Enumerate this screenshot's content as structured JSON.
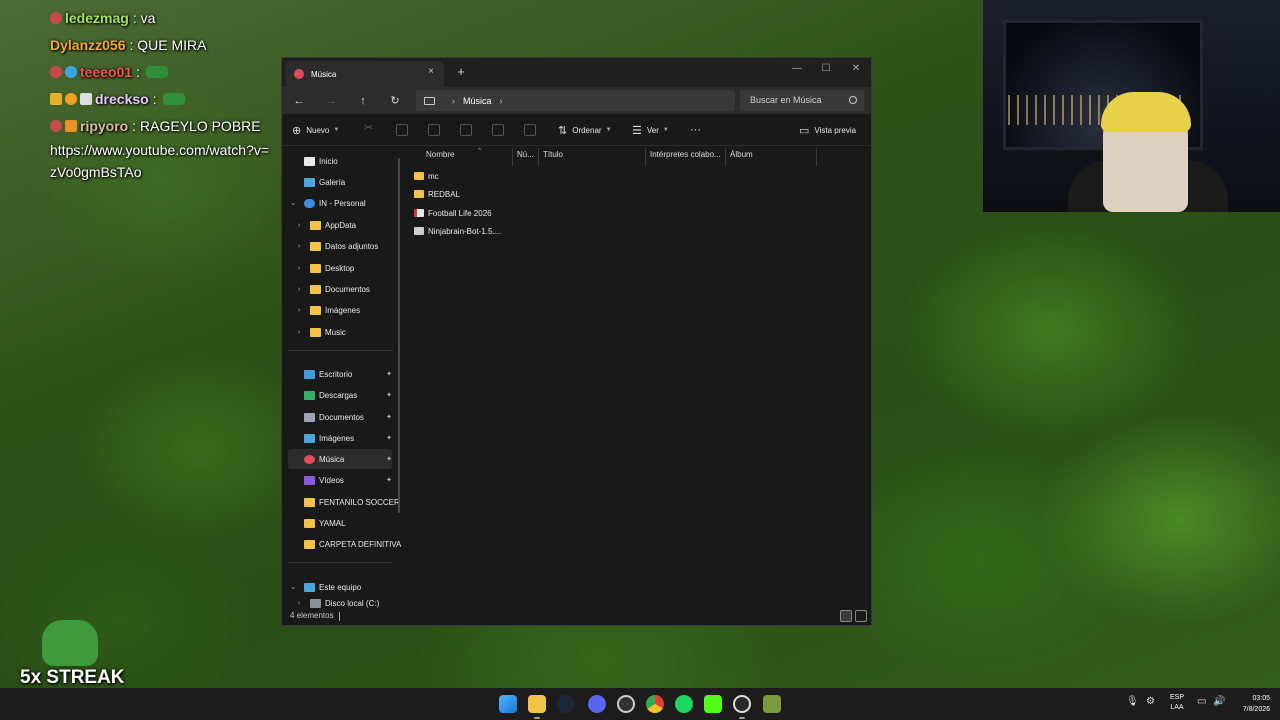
{
  "chat": {
    "messages": [
      {
        "user": "ledezmag",
        "user_color": "#a6e35a",
        "text": ": va"
      },
      {
        "user": "Dylanzz056",
        "user_color": "#f2a93b",
        "text": ": QUE MIRA"
      },
      {
        "user": "teeeo01",
        "user_color": "#ff4f4f",
        "text": ":"
      },
      {
        "user": "dreckso",
        "user_color": "#e8c9ff",
        "text": ":"
      },
      {
        "user": "ripyoro",
        "user_color": "#d9b9a0",
        "text": ": RAGEYLO POBRE"
      }
    ],
    "url_message": "https://www.youtube.com/watch?v=zVo0gmBsTAo"
  },
  "streak": {
    "label": "5x STREAK"
  },
  "explorer": {
    "tab_title": "Música",
    "tab_close": "×",
    "new_tab": "+",
    "breadcrumb": "Música",
    "search_placeholder": "Buscar en Música",
    "commands": {
      "new": "Nuevo",
      "sort": "Ordenar",
      "view": "Ver",
      "more": "···",
      "preview": "Vista previa"
    },
    "sidebar": {
      "top": [
        {
          "label": "Inicio",
          "icon": "home-icon"
        },
        {
          "label": "Galería",
          "icon": "gallery-icon"
        },
        {
          "label": "IN - Personal",
          "icon": "onedrive-icon"
        }
      ],
      "onedrive_children": [
        "AppData",
        "Datos adjuntos",
        "Desktop",
        "Documentos",
        "Imágenes",
        "Music"
      ],
      "quick_access": [
        {
          "label": "Escritorio",
          "pinned": true
        },
        {
          "label": "Descargas",
          "pinned": true
        },
        {
          "label": "Documentos",
          "pinned": true
        },
        {
          "label": "Imágenes",
          "pinned": true
        },
        {
          "label": "Música",
          "pinned": true
        },
        {
          "label": "Vídeos",
          "pinned": true
        },
        {
          "label": "FENTANILO SOCCER",
          "pinned": false
        },
        {
          "label": "YAMAL",
          "pinned": false
        },
        {
          "label": "CARPETA DEFINITIVA",
          "pinned": false
        }
      ],
      "this_pc": "Este equipo",
      "local_disk": "Disco local (C:)"
    },
    "columns": [
      "Nombre",
      "Nú...",
      "Título",
      "Intérpretes colabo...",
      "Álbum"
    ],
    "files": [
      {
        "name": "mc",
        "type": "folder"
      },
      {
        "name": "REDBAL",
        "type": "folder"
      },
      {
        "name": "Football Life 2026",
        "type": "shortcut"
      },
      {
        "name": "Ninjabrain-Bot-1.5....",
        "type": "file"
      }
    ],
    "status": "4 elementos"
  },
  "taskbar": {
    "language": [
      "ESP",
      "LAA"
    ],
    "time": "03:05",
    "date": "7/8/2026",
    "apps": [
      "start-icon",
      "file-explorer-icon",
      "steam-icon",
      "discord-icon",
      "obs-icon",
      "chrome-icon",
      "spotify-icon",
      "kick-icon",
      "c-app-icon",
      "minecraft-icon"
    ]
  },
  "colors": {
    "accent_pink": "#e04a5a",
    "folder_yellow": "#f2c347",
    "window_bg": "#191919"
  }
}
